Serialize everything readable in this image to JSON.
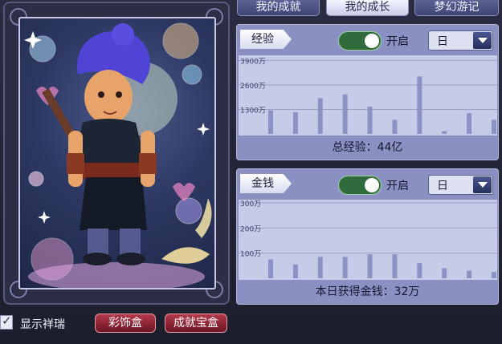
{
  "tabs": [
    {
      "label": "我的成就"
    },
    {
      "label": "我的成长"
    },
    {
      "label": "梦幻游记"
    }
  ],
  "experience": {
    "tag": "经验",
    "toggle_label": "开启",
    "period": "日",
    "y_ticks": [
      "3900万",
      "2600万",
      "1300万"
    ],
    "total_text": "总经验：44亿"
  },
  "money": {
    "tag": "金钱",
    "toggle_label": "开启",
    "period": "日",
    "y_ticks": [
      "300万",
      "200万",
      "100万"
    ],
    "total_text": "本日获得金钱：32万"
  },
  "chart_data": [
    {
      "type": "bar",
      "ylim": [
        0,
        4000
      ],
      "y_ticks": [
        1300,
        2600,
        3900
      ],
      "values": [
        1250,
        1150,
        1900,
        2100,
        1450,
        750,
        3050,
        150,
        1100,
        750
      ]
    },
    {
      "type": "bar",
      "ylim": [
        0,
        300
      ],
      "y_ticks": [
        100,
        200,
        300
      ],
      "values": [
        75,
        55,
        85,
        85,
        95,
        95,
        60,
        40,
        30,
        25
      ]
    }
  ],
  "bottom": {
    "show_label": "显示祥瑞",
    "ornament_button": "彩饰盒",
    "achievement_button": "成就宝盒"
  }
}
